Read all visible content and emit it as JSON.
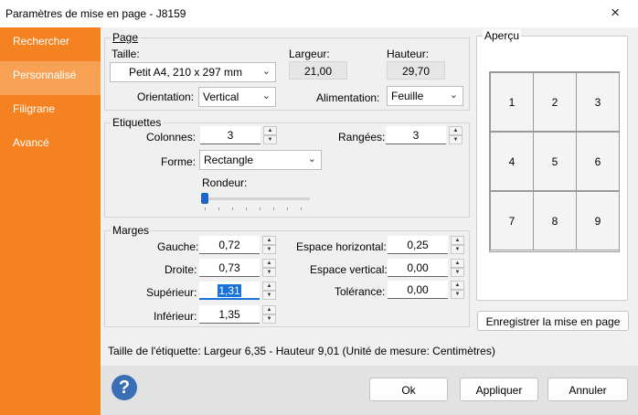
{
  "window": {
    "title": "Paramètres de mise en page - J8159",
    "close_icon": "×"
  },
  "sidebar": {
    "items": [
      {
        "label": "Rechercher"
      },
      {
        "label": "Personnalisé"
      },
      {
        "label": "Filigrane"
      },
      {
        "label": "Avancé"
      }
    ],
    "active_index": 1,
    "color": "#f58220",
    "active_color": "#f7a154"
  },
  "page": {
    "legend": "Page",
    "taille_label": "Taille:",
    "taille_value": "Petit A4, 210 x 297 mm",
    "largeur_label": "Largeur:",
    "largeur_value": "21,00",
    "hauteur_label": "Hauteur:",
    "hauteur_value": "29,70",
    "orientation_label": "Orientation:",
    "orientation_value": "Vertical",
    "alimentation_label": "Alimentation:",
    "alimentation_value": "Feuille"
  },
  "etiquettes": {
    "legend": "Etiquettes",
    "colonnes_label": "Colonnes:",
    "colonnes_value": "3",
    "rangees_label": "Rangées:",
    "rangees_value": "3",
    "forme_label": "Forme:",
    "forme_value": "Rectangle",
    "rondeur_label": "Rondeur:",
    "rondeur_level": 0
  },
  "marges": {
    "legend": "Marges",
    "gauche_label": "Gauche:",
    "gauche_value": "0,72",
    "droite_label": "Droite:",
    "droite_value": "0,73",
    "superieur_label": "Supérieur:",
    "superieur_value": "1,31",
    "inferieur_label": "Inférieur:",
    "inferieur_value": "1,35",
    "espace_h_label": "Espace horizontal:",
    "espace_h_value": "0,25",
    "espace_v_label": "Espace vertical:",
    "espace_v_value": "0,00",
    "tolerance_label": "Tolérance:",
    "tolerance_value": "0,00"
  },
  "apercu": {
    "legend": "Aperçu",
    "cells": [
      "1",
      "2",
      "3",
      "4",
      "5",
      "6",
      "7",
      "8",
      "9"
    ],
    "save_button": "Enregistrer la mise en page"
  },
  "info": "Taille de l'étiquette: Largeur 6,35 - Hauteur 9,01 (Unité de mesure: Centimètres)",
  "buttons": {
    "ok": "Ok",
    "apply": "Appliquer",
    "cancel": "Annuler"
  },
  "icons": {
    "help": "question-icon",
    "dropdown": "chevron-down-icon",
    "spin_up": "arrow-up-icon",
    "spin_down": "arrow-down-icon"
  },
  "colors": {
    "accent": "#f58220",
    "help": "#3b6fb5",
    "selection": "#1a73d9",
    "slider": "#1c64c9"
  }
}
